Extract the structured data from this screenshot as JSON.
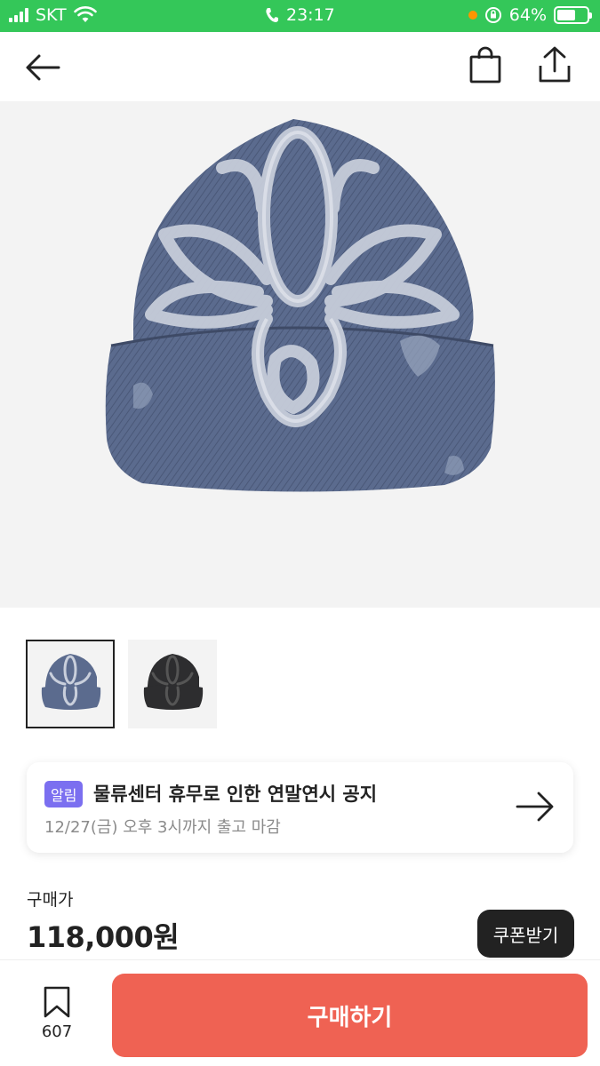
{
  "status_bar": {
    "carrier": "SKT",
    "time": "23:17",
    "battery": "64%",
    "battery_level": 0.64
  },
  "nav": {
    "back_icon": "arrow-left-icon",
    "bag_icon": "shopping-bag-icon",
    "share_icon": "share-icon"
  },
  "product": {
    "images": [
      {
        "icon": "denim-cap-blue",
        "selected": true
      },
      {
        "icon": "denim-cap-black",
        "selected": false
      }
    ]
  },
  "notice": {
    "badge": "알림",
    "title": "물류센터 휴무로 인한 연말연시 공지",
    "subtitle": "12/27(금) 오후 3시까지 출고 마감",
    "arrow_icon": "arrow-right-icon"
  },
  "price": {
    "label": "구매가",
    "value": "118,000원"
  },
  "coupon_button": "쿠폰받기",
  "bottom_bar": {
    "bookmark_icon": "bookmark-icon",
    "bookmark_count": "607",
    "buy_button": "구매하기"
  },
  "colors": {
    "status_bar": "#34c759",
    "buy_button": "#ef6253",
    "badge": "#7b6ff0",
    "coupon": "#222222"
  }
}
